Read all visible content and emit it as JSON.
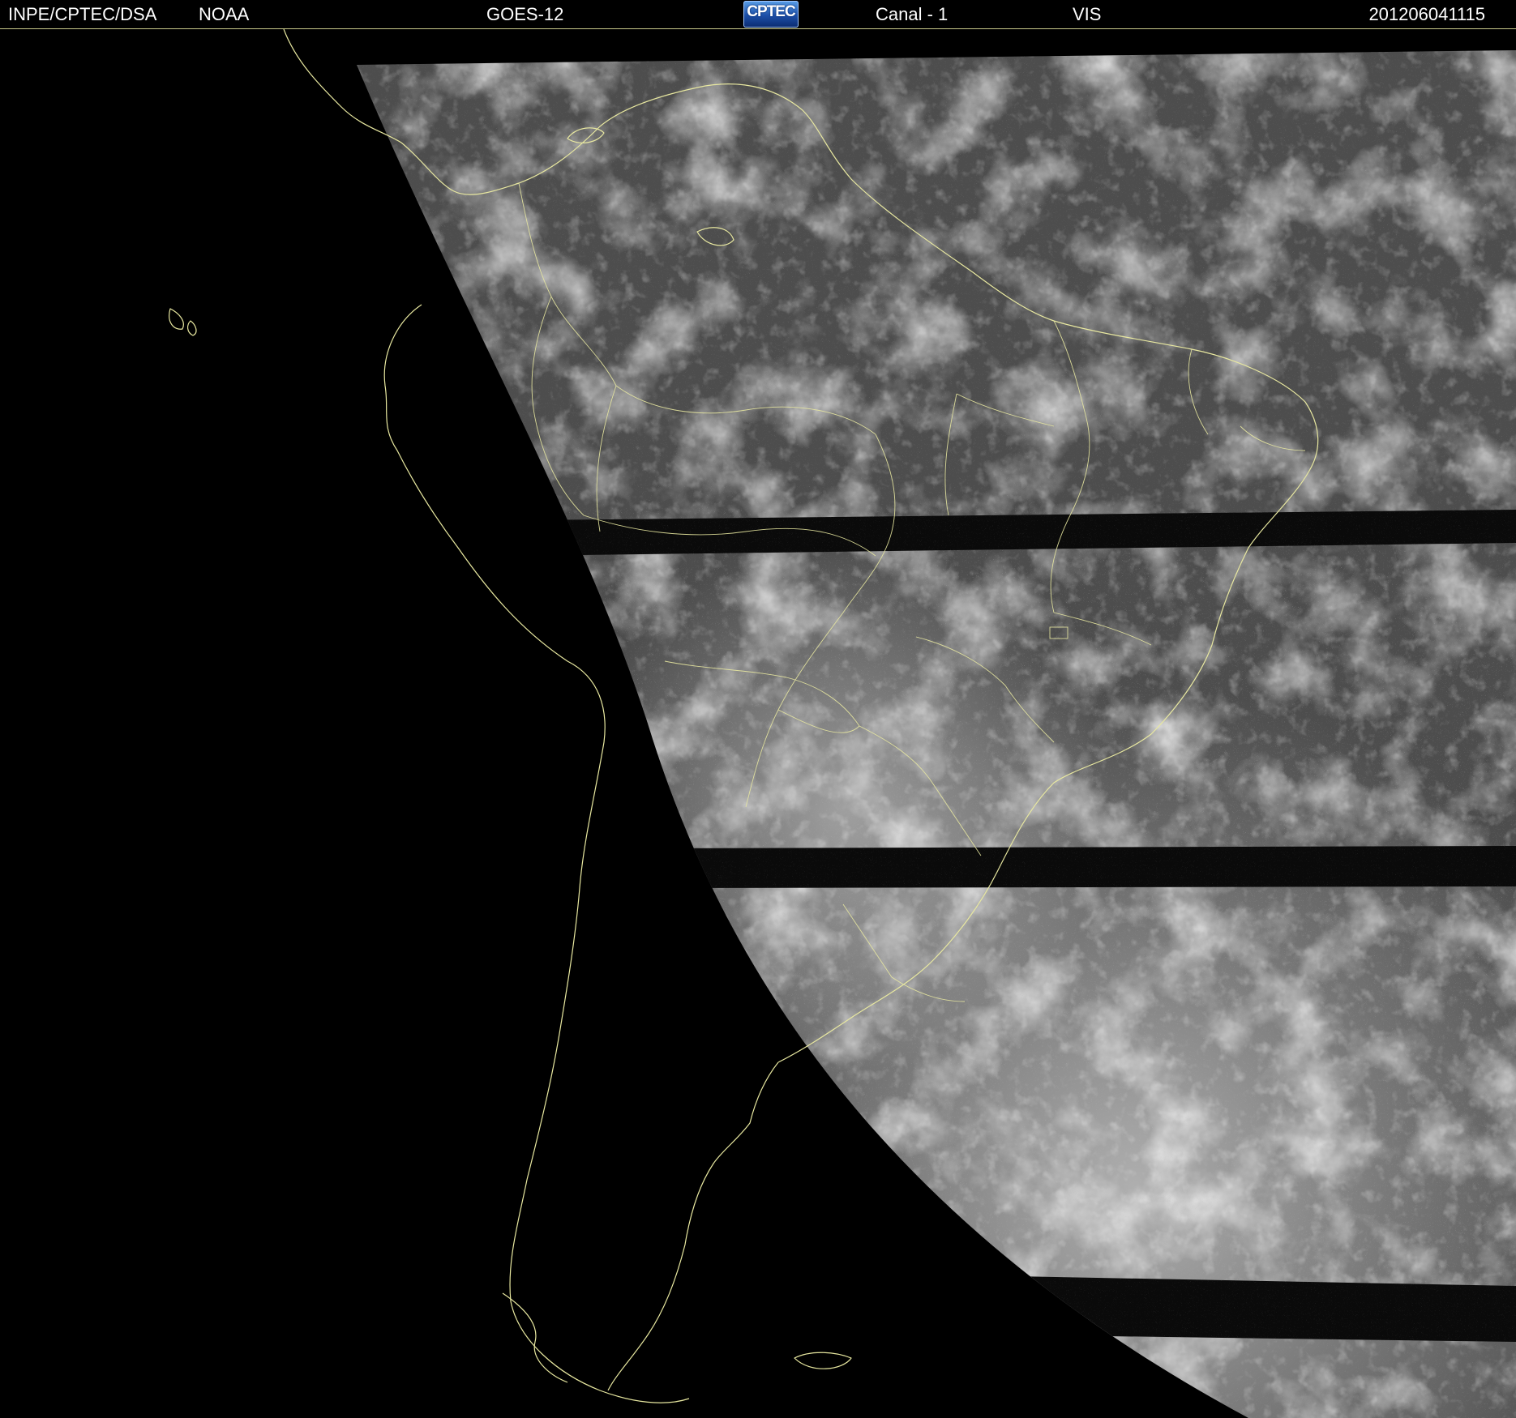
{
  "header": {
    "organization": "INPE/CPTEC/DSA",
    "agency": "NOAA",
    "satellite": "GOES-12",
    "logo_text": "CPTEC",
    "channel": "Canal - 1",
    "band": "VIS",
    "timestamp": "201206041115"
  },
  "colors": {
    "background": "#000000",
    "coastline": "#e8e8a0",
    "header_text": "#ffffff",
    "cloud_bright": "#f2f2f2",
    "ocean_land_gray": "#4a4a4a"
  }
}
